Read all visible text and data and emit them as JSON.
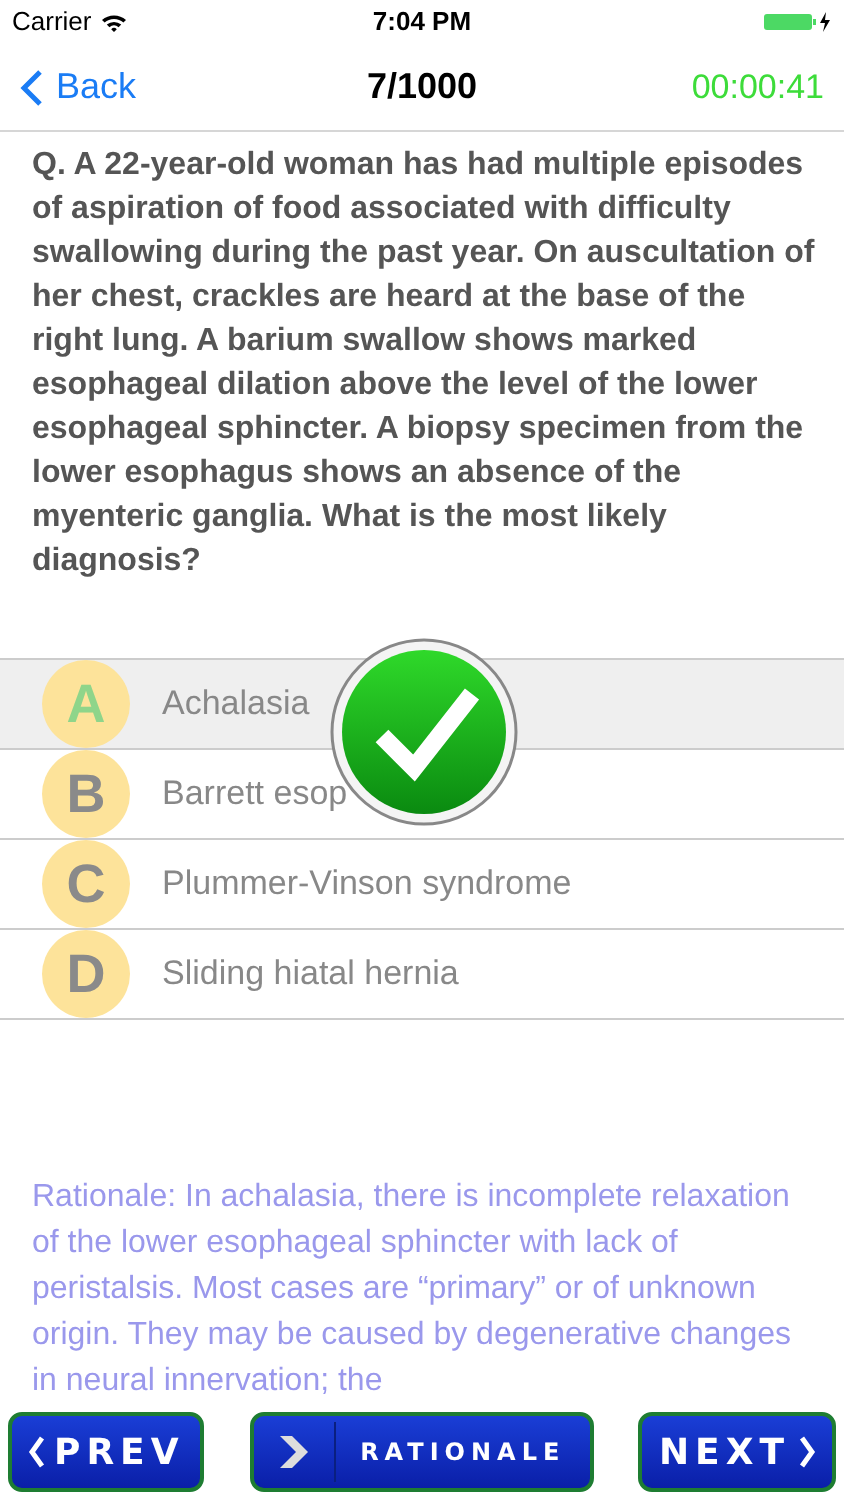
{
  "status_bar": {
    "carrier": "Carrier",
    "time": "7:04 PM"
  },
  "nav": {
    "back": "Back",
    "title": "7/1000",
    "timer": "00:00:41"
  },
  "question": "Q. A 22-year-old woman has had multiple episodes of aspiration of food associated with difficulty swallowing during the past year. On auscultation of her chest, crackles are heard at the base of the right lung. A barium swallow shows marked esophageal dilation above the level of the lower esophageal sphincter. A biopsy specimen from the lower esophagus shows an absence of the myenteric ganglia. What is the most likely diagnosis?",
  "options": [
    {
      "letter": "A",
      "text": "Achalasia",
      "selected": true
    },
    {
      "letter": "B",
      "text": "Barrett esop",
      "selected": false
    },
    {
      "letter": "C",
      "text": "Plummer-Vinson syndrome",
      "selected": false
    },
    {
      "letter": "D",
      "text": "Sliding hiatal hernia",
      "selected": false
    }
  ],
  "result": {
    "kind": "correct"
  },
  "rationale": "Rationale: In achalasia, there is incomplete relaxation of the lower esophageal sphincter with lack of peristalsis. Most cases are “primary” or of unknown origin. They may be caused by degenerative changes in neural innervation; the",
  "buttons": {
    "prev": "PREV",
    "rationale": "RATIONALE",
    "next": "NEXT"
  }
}
